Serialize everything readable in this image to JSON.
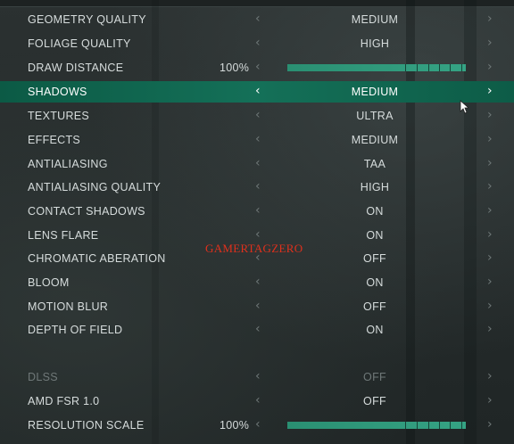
{
  "settings": [
    {
      "label": "GEOMETRY QUALITY",
      "value": "MEDIUM"
    },
    {
      "label": "FOLIAGE QUALITY",
      "value": "HIGH"
    },
    {
      "label": "DRAW DISTANCE",
      "percent": "100%",
      "slider_fraction": 1.0
    },
    {
      "label": "SHADOWS",
      "value": "MEDIUM",
      "selected": true
    },
    {
      "label": "TEXTURES",
      "value": "ULTRA"
    },
    {
      "label": "EFFECTS",
      "value": "MEDIUM"
    },
    {
      "label": "ANTIALIASING",
      "value": "TAA"
    },
    {
      "label": "ANTIALIASING QUALITY",
      "value": "HIGH"
    },
    {
      "label": "CONTACT SHADOWS",
      "value": "ON"
    },
    {
      "label": "LENS FLARE",
      "value": "ON"
    },
    {
      "label": "CHROMATIC ABERATION",
      "value": "OFF"
    },
    {
      "label": "BLOOM",
      "value": "ON"
    },
    {
      "label": "MOTION BLUR",
      "value": "OFF"
    },
    {
      "label": "DEPTH OF FIELD",
      "value": "ON"
    },
    {
      "label": "DLSS",
      "value": "OFF",
      "disabled": true
    },
    {
      "label": "AMD FSR 1.0",
      "value": "OFF"
    },
    {
      "label": "RESOLUTION SCALE",
      "percent": "100%",
      "slider_fraction": 1.0
    }
  ],
  "icons": {
    "left": "‹",
    "right": "›"
  },
  "watermark": "GAMERTAGZERO",
  "colors": {
    "selected_row": "#147058",
    "slider_fill": "#2a8f72",
    "watermark": "#e0301c"
  }
}
